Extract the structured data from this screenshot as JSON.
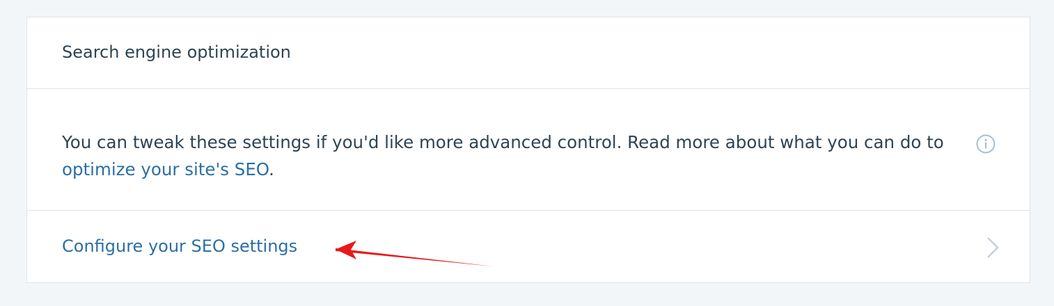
{
  "seo_card": {
    "title": "Search engine optimization",
    "description_prefix": "You can tweak these settings if you'd like more advanced control. Read more about what you can do to ",
    "description_link": "optimize your site's SEO",
    "description_suffix": ".",
    "configure_link": "Configure your SEO settings"
  },
  "icons": {
    "info": "info-circle-icon",
    "chevron": "chevron-right-icon"
  },
  "annotation": {
    "arrow_color": "#e8191a",
    "arrow_target": "configure_link"
  },
  "colors": {
    "page_background": "#f3f6f8",
    "card_background": "#ffffff",
    "border": "#dde3e8",
    "text": "#2e4453",
    "link": "#2b6fa3",
    "icon": "#a8bece"
  }
}
